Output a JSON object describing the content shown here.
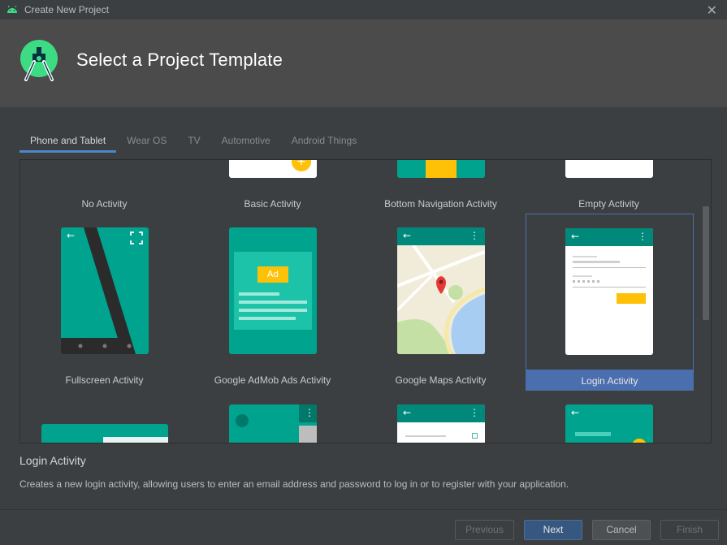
{
  "window": {
    "title": "Create New Project",
    "close_glyph": "✕"
  },
  "header": {
    "title": "Select a Project Template"
  },
  "tabs": [
    {
      "label": "Phone and Tablet",
      "active": true
    },
    {
      "label": "Wear OS",
      "active": false
    },
    {
      "label": "TV",
      "active": false
    },
    {
      "label": "Automotive",
      "active": false
    },
    {
      "label": "Android Things",
      "active": false
    }
  ],
  "templates": {
    "row1": [
      "No Activity",
      "Basic Activity",
      "Bottom Navigation Activity",
      "Empty Activity"
    ],
    "row2": [
      "Fullscreen Activity",
      "Google AdMob Ads Activity",
      "Google Maps Activity",
      "Login Activity"
    ]
  },
  "ad_badge": "Ad",
  "selected_template": "Login Activity",
  "description": {
    "title": "Login Activity",
    "text": "Creates a new login activity, allowing users to enter an email address and password to log in or to register with your application."
  },
  "buttons": {
    "previous": "Previous",
    "next": "Next",
    "cancel": "Cancel",
    "finish": "Finish"
  },
  "colors": {
    "accent": "#4b6eaf",
    "teal": "#00a38d",
    "teal_dark": "#00897b",
    "amber": "#ffc107",
    "android_green": "#3ddc84"
  },
  "icons": {
    "back": "←",
    "more": "⋮",
    "fab_plus": "+"
  }
}
